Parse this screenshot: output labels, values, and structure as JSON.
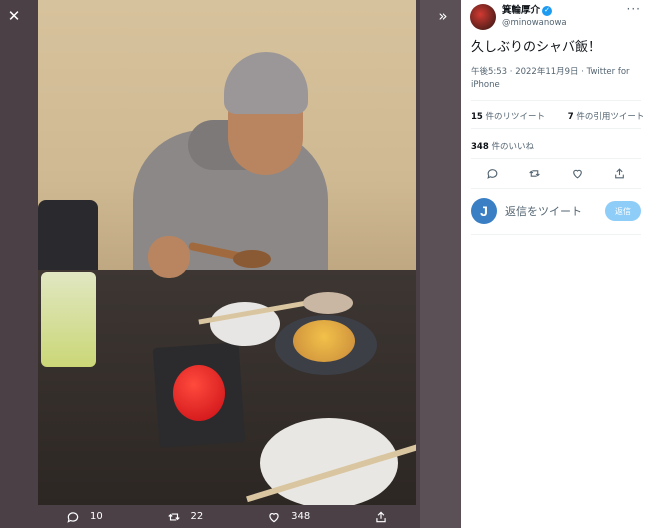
{
  "media": {
    "actions": {
      "reply_count": "10",
      "retweet_count": "22",
      "like_count": "348"
    }
  },
  "tweet": {
    "display_name": "箕輪厚介",
    "handle": "@minowanowa",
    "text": "久しぶりのシャバ飯！",
    "meta": "午後5:53 · 2022年11月9日 · Twitter for iPhone",
    "retweets_num": "15",
    "retweets_label": " 件のリツイート",
    "quotes_num": "7",
    "quotes_label": " 件の引用ツイート",
    "likes_num": "348",
    "likes_label": " 件のいいね"
  },
  "reply": {
    "avatar_letter": "J",
    "placeholder": "返信をツイート",
    "button_label": "返信"
  },
  "colors": {
    "accent": "#1d9bf0",
    "reply_button": "#8ecdf7",
    "media_bg": "#37353a"
  }
}
